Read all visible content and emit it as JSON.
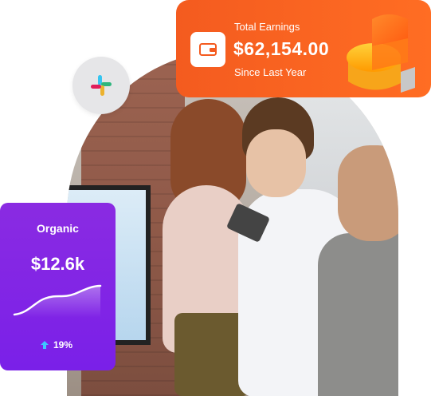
{
  "earnings_card": {
    "title": "Total Earnings",
    "amount": "$62,154.00",
    "subtitle": "Since Last Year",
    "icon": "wallet-icon",
    "accent": "#f45b1f"
  },
  "organic_card": {
    "title": "Organic",
    "value": "$12.6k",
    "change": "19%",
    "trend_icon": "arrow-up-icon",
    "accent": "#7a20e8",
    "trend_color": "#3ec6ff"
  },
  "slack_badge": {
    "icon": "slack-icon"
  }
}
